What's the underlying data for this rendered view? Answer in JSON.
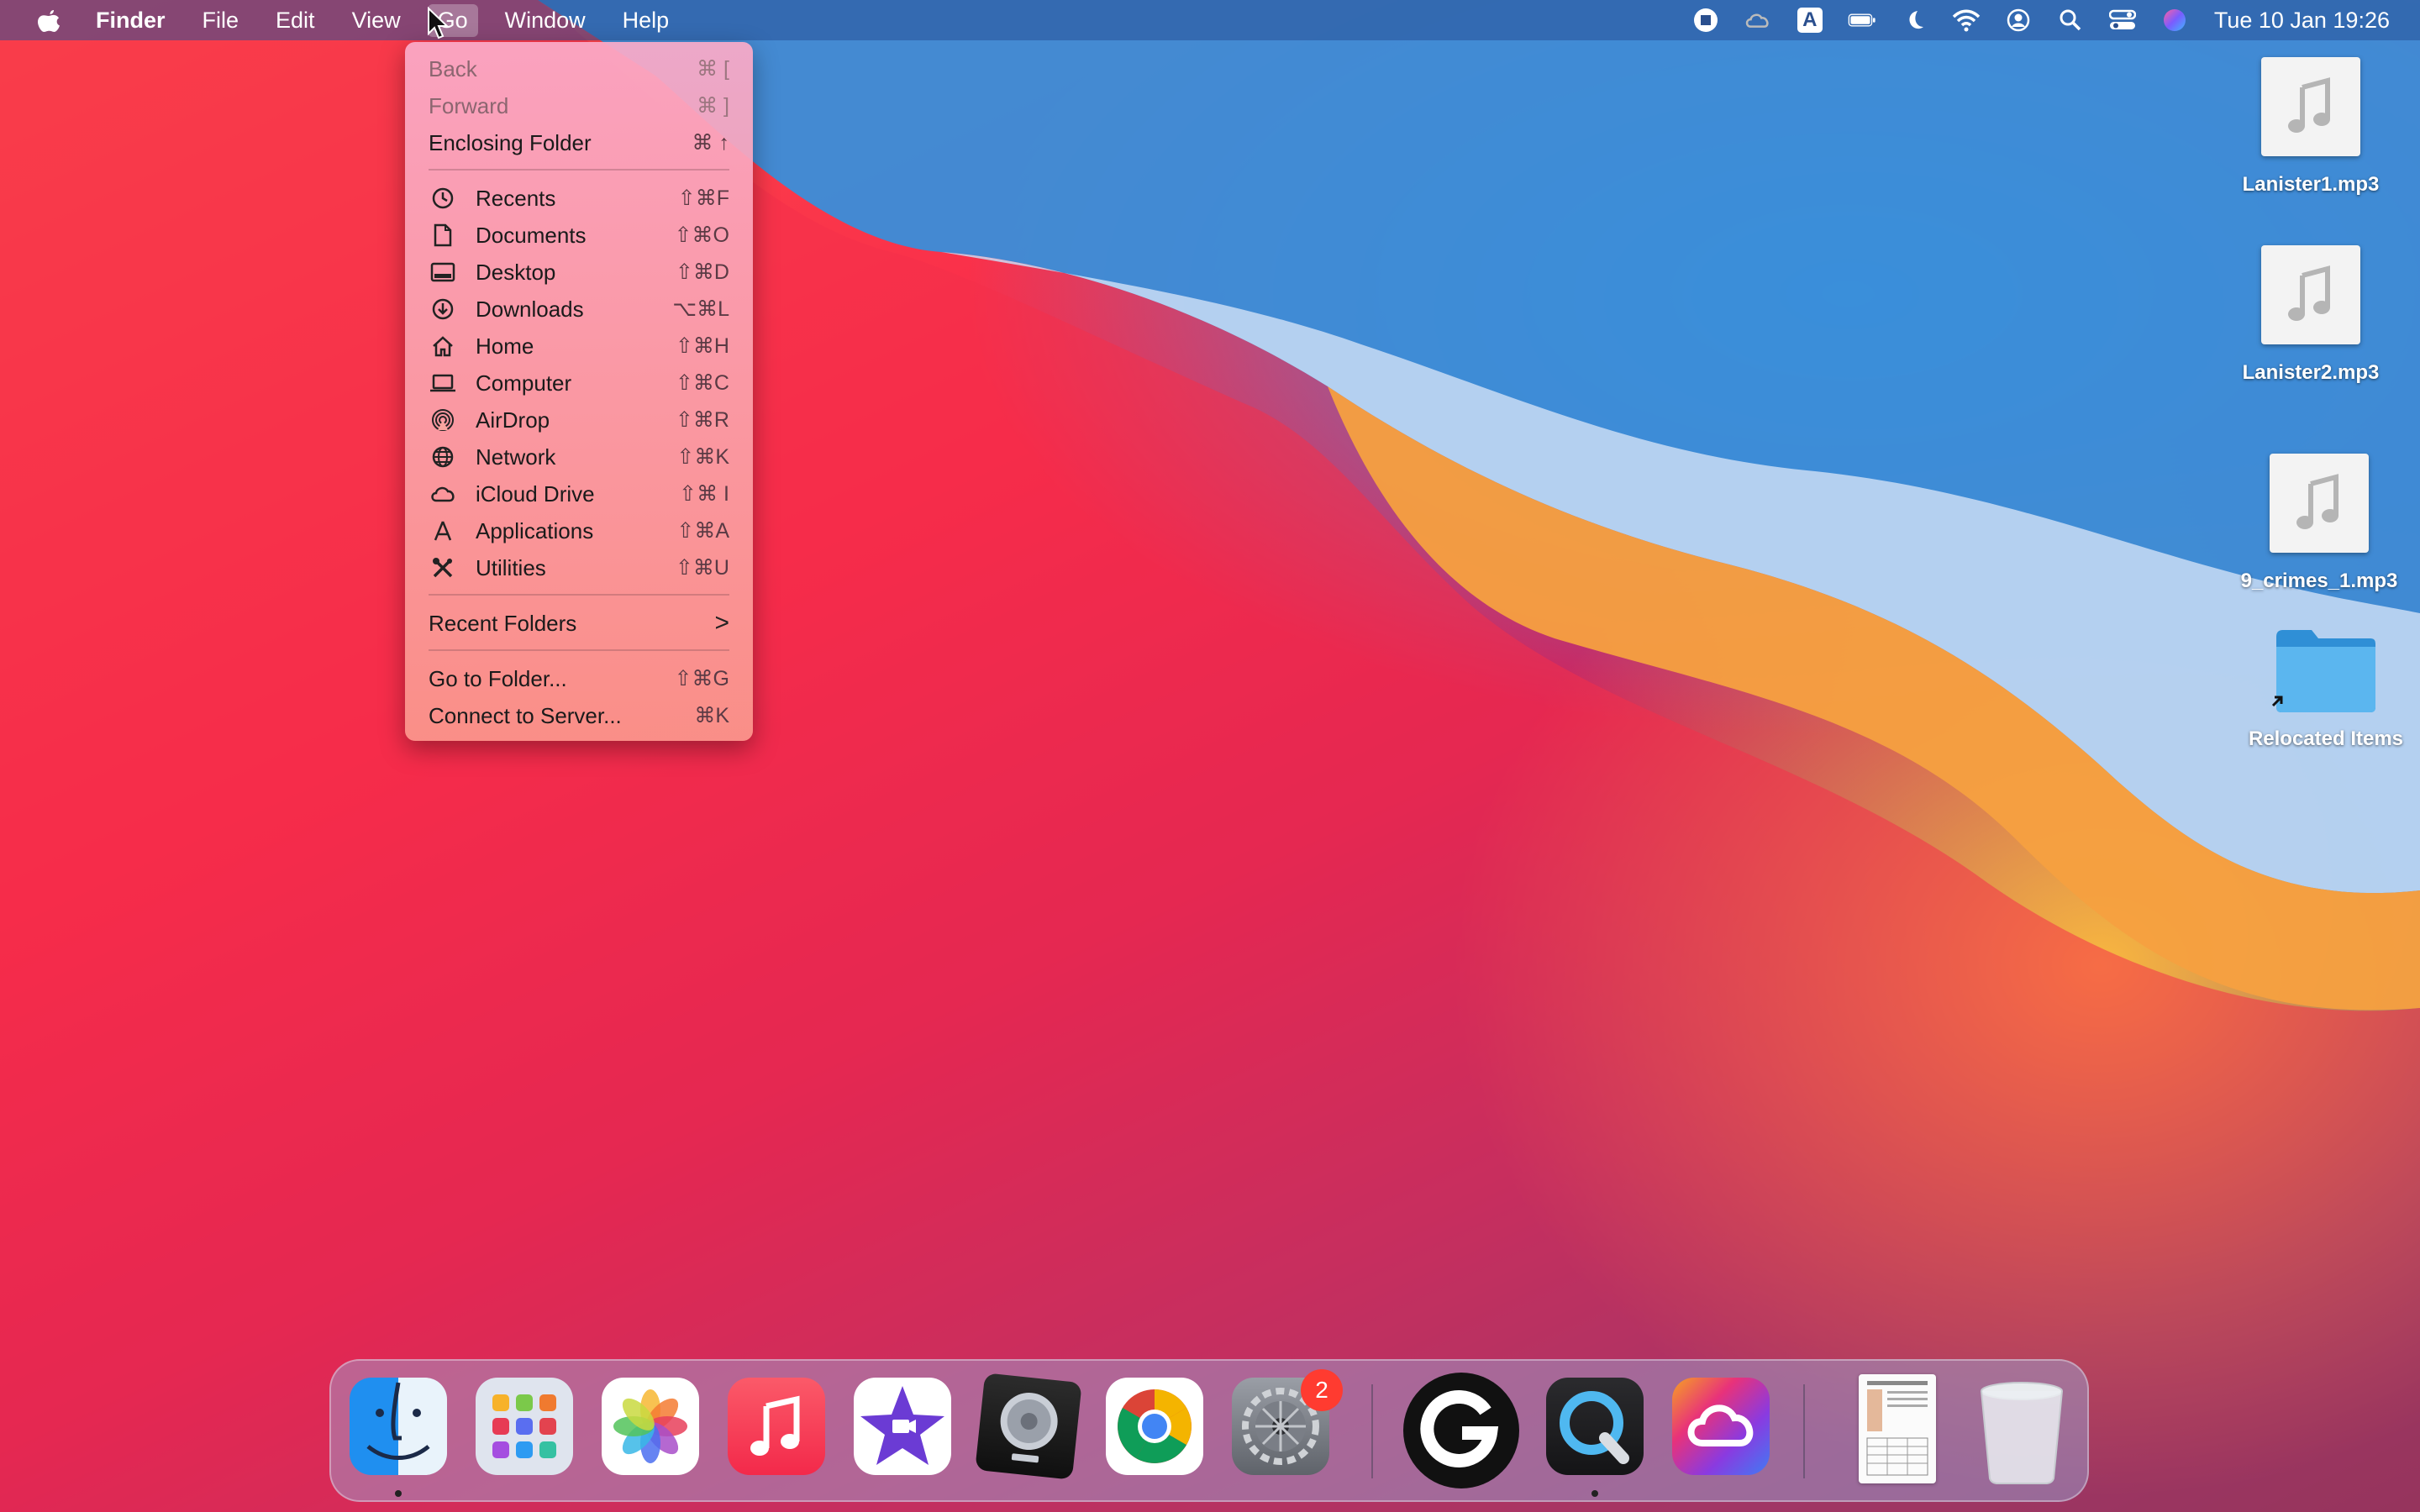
{
  "menubar": {
    "app_name": "Finder",
    "menus": [
      "File",
      "Edit",
      "View",
      "Go",
      "Window",
      "Help"
    ],
    "clock": "Tue 10 Jan  19:26",
    "status_icons": [
      "stop-recording-icon",
      "creative-cloud-icon",
      "input-source-icon",
      "battery-icon",
      "focus-moon-icon",
      "wifi-icon",
      "user-icon",
      "spotlight-search-icon",
      "control-center-icon",
      "siri-icon"
    ],
    "input_source_letter": "A"
  },
  "go_menu": {
    "items": [
      {
        "label": "Back",
        "shortcut": "⌘ [",
        "disabled": true
      },
      {
        "label": "Forward",
        "shortcut": "⌘ ]",
        "disabled": true
      },
      {
        "label": "Enclosing Folder",
        "shortcut": "⌘ ↑",
        "disabled": false
      },
      {
        "label": "Recents",
        "shortcut": "⇧⌘F",
        "icon": "clock-icon"
      },
      {
        "label": "Documents",
        "shortcut": "⇧⌘O",
        "icon": "document-icon"
      },
      {
        "label": "Desktop",
        "shortcut": "⇧⌘D",
        "icon": "desktop-icon"
      },
      {
        "label": "Downloads",
        "shortcut": "⌥⌘L",
        "icon": "download-icon"
      },
      {
        "label": "Home",
        "shortcut": "⇧⌘H",
        "icon": "home-icon"
      },
      {
        "label": "Computer",
        "shortcut": "⇧⌘C",
        "icon": "laptop-icon"
      },
      {
        "label": "AirDrop",
        "shortcut": "⇧⌘R",
        "icon": "airdrop-icon"
      },
      {
        "label": "Network",
        "shortcut": "⇧⌘K",
        "icon": "globe-icon"
      },
      {
        "label": "iCloud Drive",
        "shortcut": "⇧⌘ I",
        "icon": "cloud-icon"
      },
      {
        "label": "Applications",
        "shortcut": "⇧⌘A",
        "icon": "applications-icon"
      },
      {
        "label": "Utilities",
        "shortcut": "⇧⌘U",
        "icon": "tools-icon"
      },
      {
        "label": "Recent Folders",
        "shortcut": ">"
      },
      {
        "label": "Go to Folder...",
        "shortcut": "⇧⌘G"
      },
      {
        "label": "Connect to Server...",
        "shortcut": "⌘K"
      }
    ]
  },
  "desktop_items": [
    {
      "name": "Lanister1.mp3",
      "kind": "audio-file-icon"
    },
    {
      "name": "Lanister2.mp3",
      "kind": "audio-file-icon"
    },
    {
      "name": "9_crimes_1.mp3",
      "kind": "audio-file-icon"
    },
    {
      "name": "Relocated Items",
      "kind": "folder-alias-icon"
    }
  ],
  "dock": {
    "apps": [
      "Finder",
      "Launchpad",
      "Photos",
      "Music",
      "iMovie",
      "Logic Pro",
      "Google Chrome",
      "System Preferences",
      "Logitech G HUB",
      "QuickTime Player",
      "Creative Cloud",
      "Document",
      "Trash"
    ],
    "system_prefs_badge": "2"
  },
  "colors": {
    "menubar": "#2a5196",
    "menu_bg": "#f9a9bf",
    "badge": "#ff3b30",
    "folder": "#4aa9e8"
  }
}
